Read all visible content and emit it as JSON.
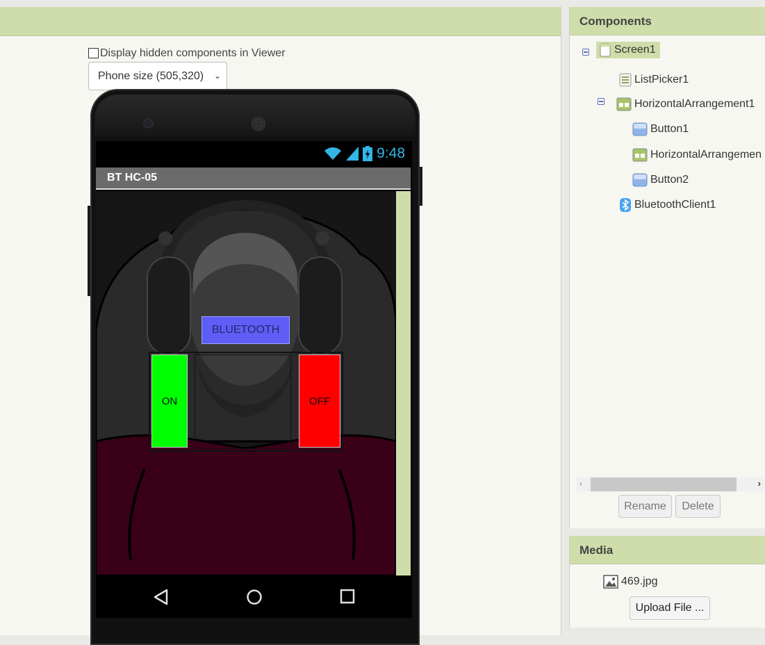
{
  "viewer": {
    "hidden_label": "Display hidden components in Viewer",
    "phone_size": "Phone size (505,320)"
  },
  "phone": {
    "status_time": "9:48",
    "app_title": "BT HC-05",
    "bluetooth_label": "BLUETOOTH",
    "on_label": "ON",
    "off_label": "OFF",
    "colors": {
      "bluetooth": "#5e5ef6",
      "on": "#00ff00",
      "off": "#ff0000",
      "accent": "#cfddaa"
    }
  },
  "components": {
    "title": "Components",
    "items": [
      {
        "label": "Screen1",
        "icon": "screen-icon"
      },
      {
        "label": "ListPicker1",
        "icon": "listpicker-icon"
      },
      {
        "label": "HorizontalArrangement1",
        "icon": "arrangement-icon"
      },
      {
        "label": "Button1",
        "icon": "button-icon"
      },
      {
        "label": "HorizontalArrangemen",
        "icon": "arrangement-icon"
      },
      {
        "label": "Button2",
        "icon": "button-icon"
      },
      {
        "label": "BluetoothClient1",
        "icon": "bluetooth-icon"
      }
    ],
    "rename_label": "Rename",
    "delete_label": "Delete"
  },
  "media": {
    "title": "Media",
    "file": "469.jpg",
    "upload_label": "Upload File ..."
  }
}
